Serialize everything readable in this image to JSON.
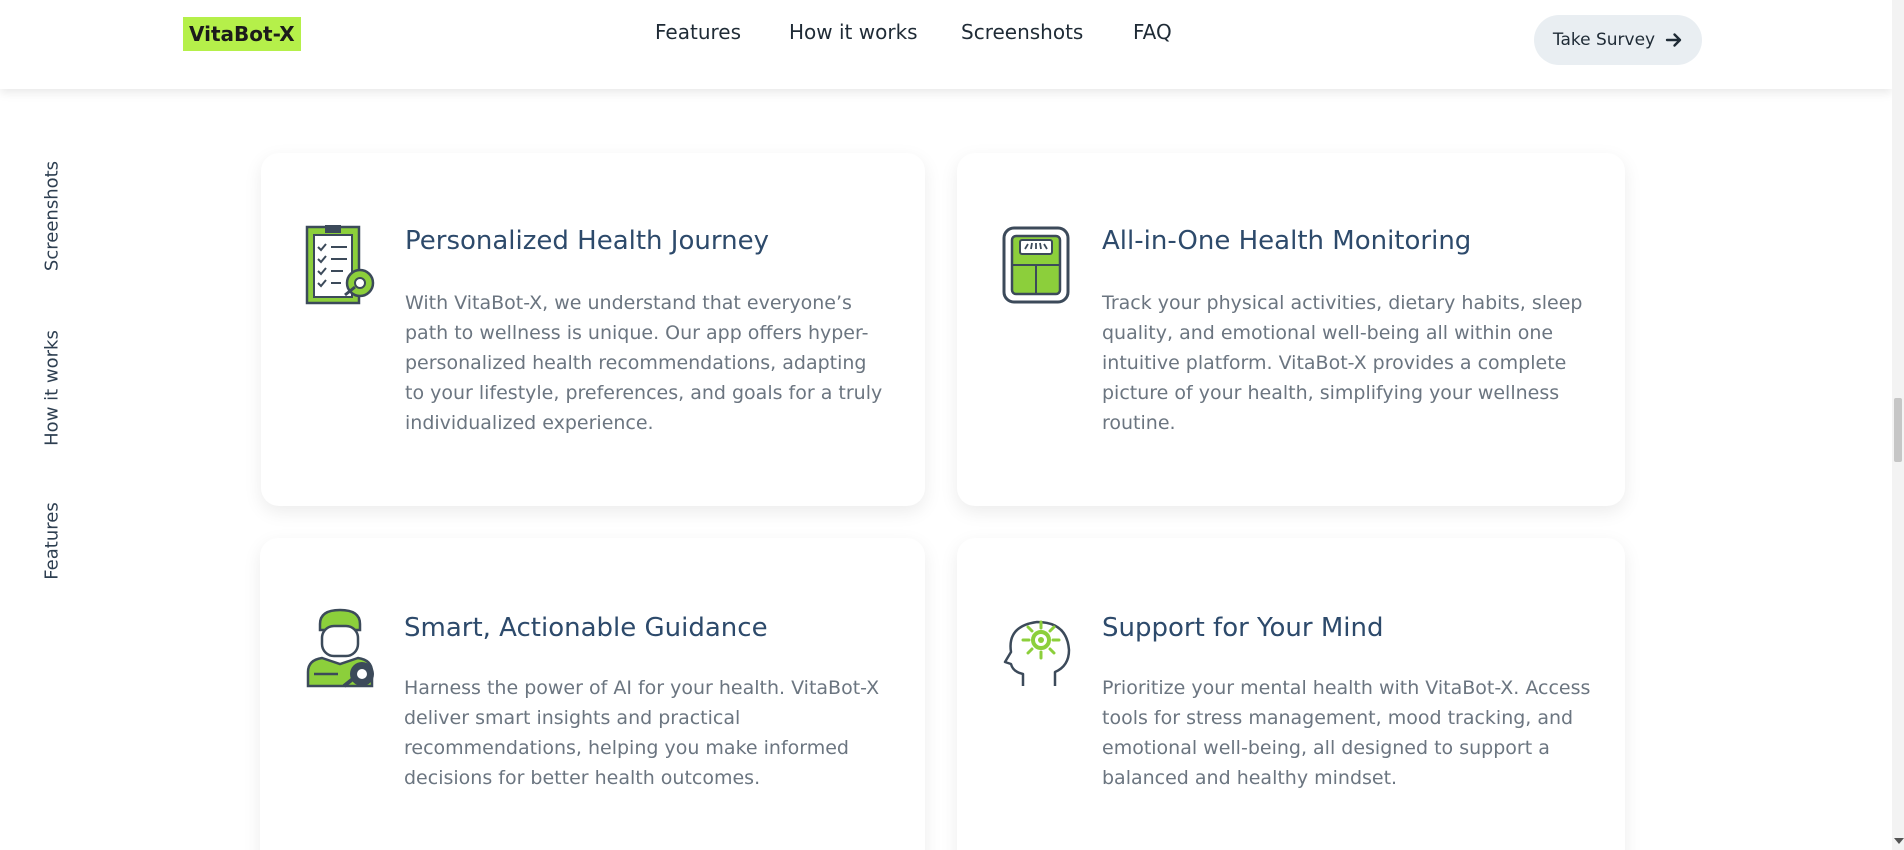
{
  "header": {
    "logo": "VitaBot-X",
    "nav": [
      {
        "label": "Features"
      },
      {
        "label": "How it works"
      },
      {
        "label": "Screenshots"
      },
      {
        "label": "FAQ"
      }
    ],
    "cta_label": "Take Survey",
    "cta_icon": "arrow-right-icon"
  },
  "side_nav": [
    {
      "label": "Screenshots"
    },
    {
      "label": "How it works"
    },
    {
      "label": "Features"
    }
  ],
  "cards": [
    {
      "icon": "checklist-clipboard-icon",
      "title": "Personalized Health Journey",
      "description": "With VitaBot-X, we understand that everyone’s path to wellness is unique. Our app offers hyper-personalized health recommendations, adapting to your lifestyle, preferences, and goals for a truly individualized experience."
    },
    {
      "icon": "weighing-scale-icon",
      "title": "All-in-One Health Monitoring",
      "description": "Track your physical activities, dietary habits, sleep quality, and emotional well-being all within one intuitive platform. VitaBot-X provides a complete picture of your health, simplifying your wellness routine."
    },
    {
      "icon": "person-guidance-icon",
      "title": "Smart, Actionable Guidance",
      "description": "Harness the power of AI for your health. VitaBot-X deliver smart insights and practical recommendations, helping you make informed decisions for better health outcomes."
    },
    {
      "icon": "mind-head-icon",
      "title": "Support for Your Mind",
      "description": "Prioritize your mental health with VitaBot-X. Access tools for stress management, mood tracking, and emotional well-being, all designed to support a balanced and healthy mindset."
    }
  ],
  "colors": {
    "accent": "#b5f04a",
    "icon_green": "#8ccf3b",
    "icon_stroke": "#3c4a5a",
    "title": "#2d4a6b",
    "body_text": "#6b7580"
  }
}
